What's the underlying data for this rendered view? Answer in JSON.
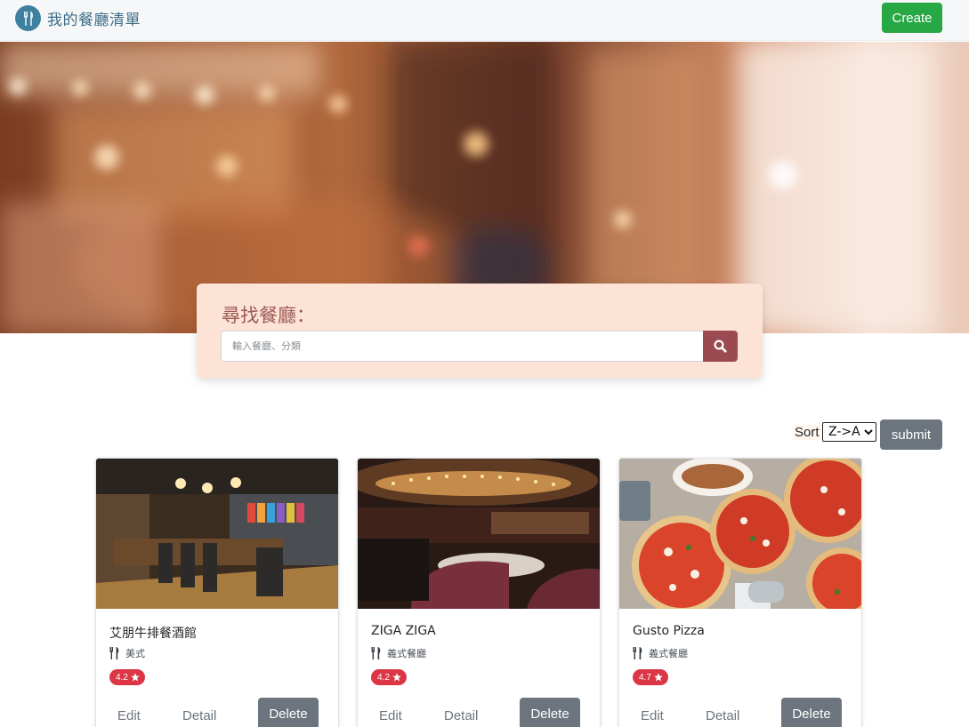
{
  "navbar": {
    "brand": "我的餐廳清單",
    "brand_icon": "utensils-icon",
    "create_label": "Create"
  },
  "search": {
    "title": "尋找餐廳：",
    "placeholder": "輸入餐廳、分類",
    "button_icon": "search-icon"
  },
  "sort": {
    "label": "Sort",
    "selected": "Z->A",
    "submit_label": "submit"
  },
  "restaurants": [
    {
      "name": "艾朋牛排餐酒館",
      "category": "美式",
      "rating": "4.2"
    },
    {
      "name": "ZIGA ZIGA",
      "category": "義式餐廳",
      "rating": "4.2"
    },
    {
      "name": "Gusto Pizza",
      "category": "義式餐廳",
      "rating": "4.7"
    }
  ],
  "card_actions": {
    "edit": "Edit",
    "detail": "Detail",
    "delete": "Delete"
  },
  "colors": {
    "create_green": "#28a745",
    "search_panel": "#fde3d6",
    "search_button": "#9b4b50",
    "rating_red": "#dc3545",
    "secondary_gray": "#6c757d"
  }
}
